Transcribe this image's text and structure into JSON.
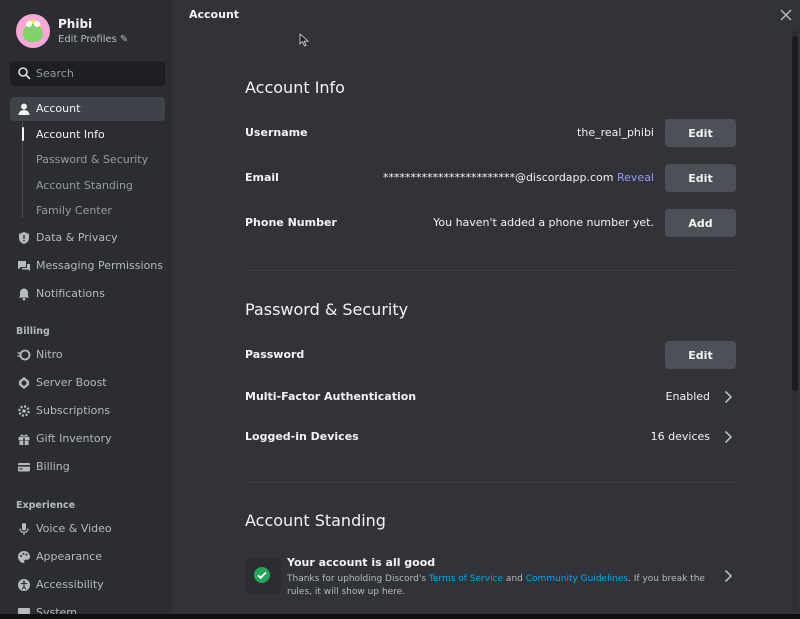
{
  "profile": {
    "name": "Phibi",
    "edit_label": "Edit Profiles"
  },
  "search": {
    "placeholder": "Search"
  },
  "sidebar": {
    "account": "Account",
    "subitems": [
      "Account Info",
      "Password & Security",
      "Account Standing",
      "Family Center"
    ],
    "user_settings": [
      "Data & Privacy",
      "Messaging Permissions",
      "Notifications"
    ],
    "billing_header": "Billing",
    "billing": [
      "Nitro",
      "Server Boost",
      "Subscriptions",
      "Gift Inventory",
      "Billing"
    ],
    "experience_header": "Experience",
    "experience": [
      "Voice & Video",
      "Appearance",
      "Accessibility",
      "System"
    ]
  },
  "page": {
    "title": "Account"
  },
  "account_info": {
    "heading": "Account Info",
    "username_label": "Username",
    "username_value": "the_real_phibi",
    "email_label": "Email",
    "email_value": "************************@discordapp.com",
    "reveal": "Reveal",
    "phone_label": "Phone Number",
    "phone_value": "You haven't added a phone number yet.",
    "edit": "Edit",
    "add": "Add"
  },
  "password_security": {
    "heading": "Password & Security",
    "password_label": "Password",
    "edit": "Edit",
    "mfa_label": "Multi-Factor Authentication",
    "mfa_value": "Enabled",
    "devices_label": "Logged-in Devices",
    "devices_value": "16 devices"
  },
  "account_standing": {
    "heading": "Account Standing",
    "title": "Your account is all good",
    "desc_1": "Thanks for upholding Discord's ",
    "tos": "Terms of Service",
    "and": " and ",
    "guidelines": "Community Guidelines",
    "desc_2": ". If you break the rules, it will show up here."
  },
  "colors": {
    "background": "#313338",
    "sidebar": "#2b2d31",
    "button": "#4e5058",
    "link": "#00a8fc",
    "reveal": "#949cf7",
    "success": "#23a55a"
  },
  "icons": {
    "search": "search-icon",
    "account": "person-icon",
    "data": "shield-icon",
    "messaging": "chat-bubbles-icon",
    "notifications": "bell-icon",
    "nitro": "nitro-icon",
    "boost": "boost-gem-icon",
    "subscriptions": "gear-icon",
    "gift": "gift-icon",
    "billing": "card-icon",
    "voice": "microphone-icon",
    "appearance": "palette-icon",
    "accessibility": "accessibility-icon",
    "close": "close-icon",
    "check": "check-circle-icon",
    "chevron": "chevron-right-icon",
    "pencil": "pencil-icon"
  }
}
